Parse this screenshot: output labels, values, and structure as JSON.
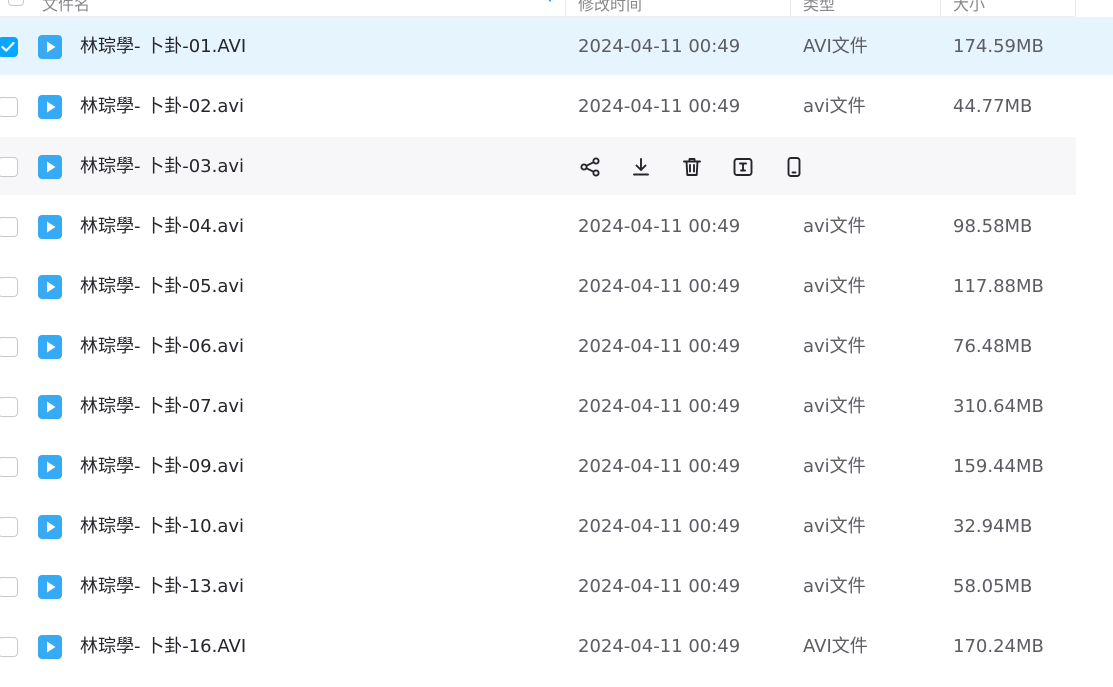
{
  "header": {
    "name": "文件名",
    "modified": "修改时间",
    "type": "类型",
    "size": "大小"
  },
  "actions": {
    "share": "share-icon",
    "download": "download-icon",
    "delete": "delete-icon",
    "rename": "rename-icon",
    "mobile": "mobile-icon"
  },
  "colors": {
    "accent": "#06a7ff",
    "selected_row": "#e6f4fe",
    "hover_row": "#f7f7f9",
    "file_icon": "#37aaf5"
  },
  "rows": [
    {
      "name": "林琮學- 卜卦-01.AVI",
      "date": "2024-04-11 00:49",
      "type": "AVI文件",
      "size": "174.59MB",
      "checked": true
    },
    {
      "name": "林琮學- 卜卦-02.avi",
      "date": "2024-04-11 00:49",
      "type": "avi文件",
      "size": "44.77MB"
    },
    {
      "name": "林琮學- 卜卦-03.avi",
      "date": "",
      "type": "",
      "size": "",
      "hovered": true
    },
    {
      "name": "林琮學- 卜卦-04.avi",
      "date": "2024-04-11 00:49",
      "type": "avi文件",
      "size": "98.58MB"
    },
    {
      "name": "林琮學- 卜卦-05.avi",
      "date": "2024-04-11 00:49",
      "type": "avi文件",
      "size": "117.88MB"
    },
    {
      "name": "林琮學- 卜卦-06.avi",
      "date": "2024-04-11 00:49",
      "type": "avi文件",
      "size": "76.48MB"
    },
    {
      "name": "林琮學- 卜卦-07.avi",
      "date": "2024-04-11 00:49",
      "type": "avi文件",
      "size": "310.64MB"
    },
    {
      "name": "林琮學- 卜卦-09.avi",
      "date": "2024-04-11 00:49",
      "type": "avi文件",
      "size": "159.44MB"
    },
    {
      "name": "林琮學- 卜卦-10.avi",
      "date": "2024-04-11 00:49",
      "type": "avi文件",
      "size": "32.94MB"
    },
    {
      "name": "林琮學- 卜卦-13.avi",
      "date": "2024-04-11 00:49",
      "type": "avi文件",
      "size": "58.05MB"
    },
    {
      "name": "林琮學- 卜卦-16.AVI",
      "date": "2024-04-11 00:49",
      "type": "AVI文件",
      "size": "170.24MB"
    }
  ]
}
